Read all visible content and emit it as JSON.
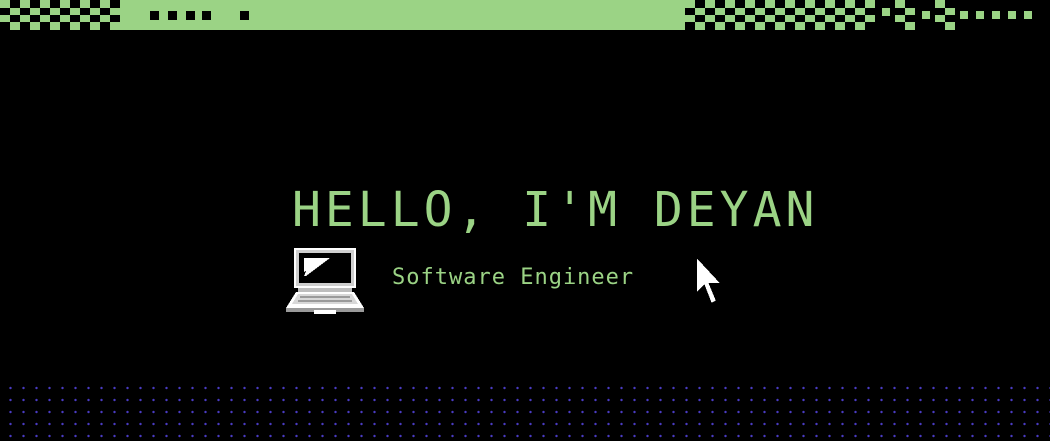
{
  "hero": {
    "title": "HELLO, I'M DEYAN",
    "subtitle": "Software Engineer"
  },
  "icons": {
    "laptop": "laptop-icon",
    "cursor": "mouse-pointer-icon"
  },
  "colors": {
    "background": "#000000",
    "accent_green": "#9bd385",
    "dot_purple": "#4a3cc4",
    "icon_white": "#ffffff"
  }
}
